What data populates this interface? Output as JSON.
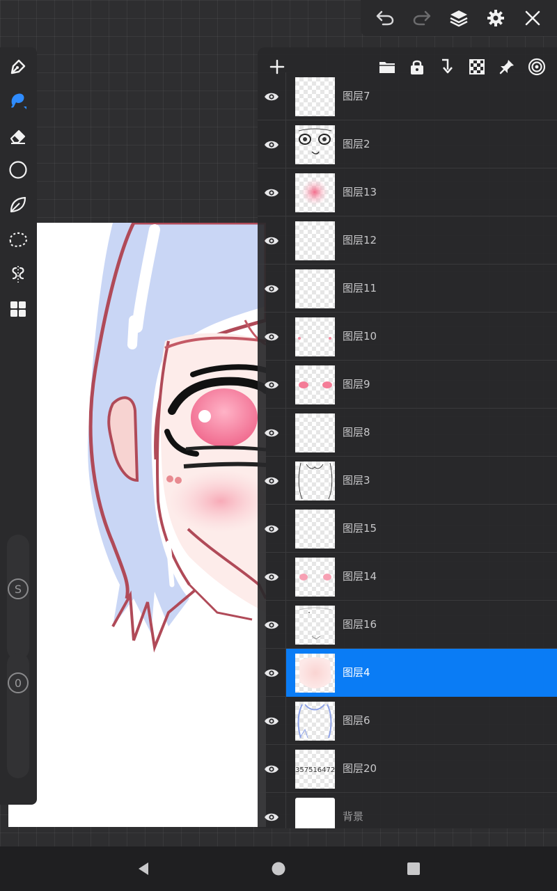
{
  "topbar": {
    "icons": [
      "undo-icon",
      "redo-icon",
      "layers-icon",
      "settings-icon",
      "close-icon"
    ]
  },
  "toolbar": {
    "tools": [
      "pen-icon",
      "smudge-icon",
      "eraser-icon",
      "shape-icon",
      "leaf-brush-icon",
      "lasso-icon",
      "symmetry-icon",
      "grid-icon"
    ],
    "size_slider_label": "S",
    "opacity_slider_label": "0"
  },
  "layer_panel": {
    "toolbar_icons": [
      "add-layer-icon",
      "folder-icon",
      "lock-icon",
      "merge-down-icon",
      "alpha-lock-icon",
      "pin-icon",
      "reference-icon"
    ],
    "layers": [
      {
        "name": "图层7",
        "visible": true,
        "selected": false
      },
      {
        "name": "图层2",
        "visible": true,
        "selected": false
      },
      {
        "name": "图层13",
        "visible": true,
        "selected": false
      },
      {
        "name": "图层12",
        "visible": true,
        "selected": false
      },
      {
        "name": "图层11",
        "visible": true,
        "selected": false
      },
      {
        "name": "图层10",
        "visible": true,
        "selected": false
      },
      {
        "name": "图层9",
        "visible": true,
        "selected": false
      },
      {
        "name": "图层8",
        "visible": true,
        "selected": false
      },
      {
        "name": "图层3",
        "visible": true,
        "selected": false
      },
      {
        "name": "图层15",
        "visible": true,
        "selected": false
      },
      {
        "name": "图层14",
        "visible": true,
        "selected": false
      },
      {
        "name": "图层16",
        "visible": true,
        "selected": false
      },
      {
        "name": "图层4",
        "visible": true,
        "selected": true
      },
      {
        "name": "图层6",
        "visible": true,
        "selected": false
      },
      {
        "name": "图层20",
        "visible": true,
        "selected": false
      },
      {
        "name": "背景",
        "visible": true,
        "selected": false
      }
    ],
    "layer20_thumb_text": "357516472 ·",
    "accent_color": "#0a7cf5"
  },
  "navbar": {
    "icons": [
      "back-icon",
      "home-icon",
      "recents-icon"
    ]
  }
}
